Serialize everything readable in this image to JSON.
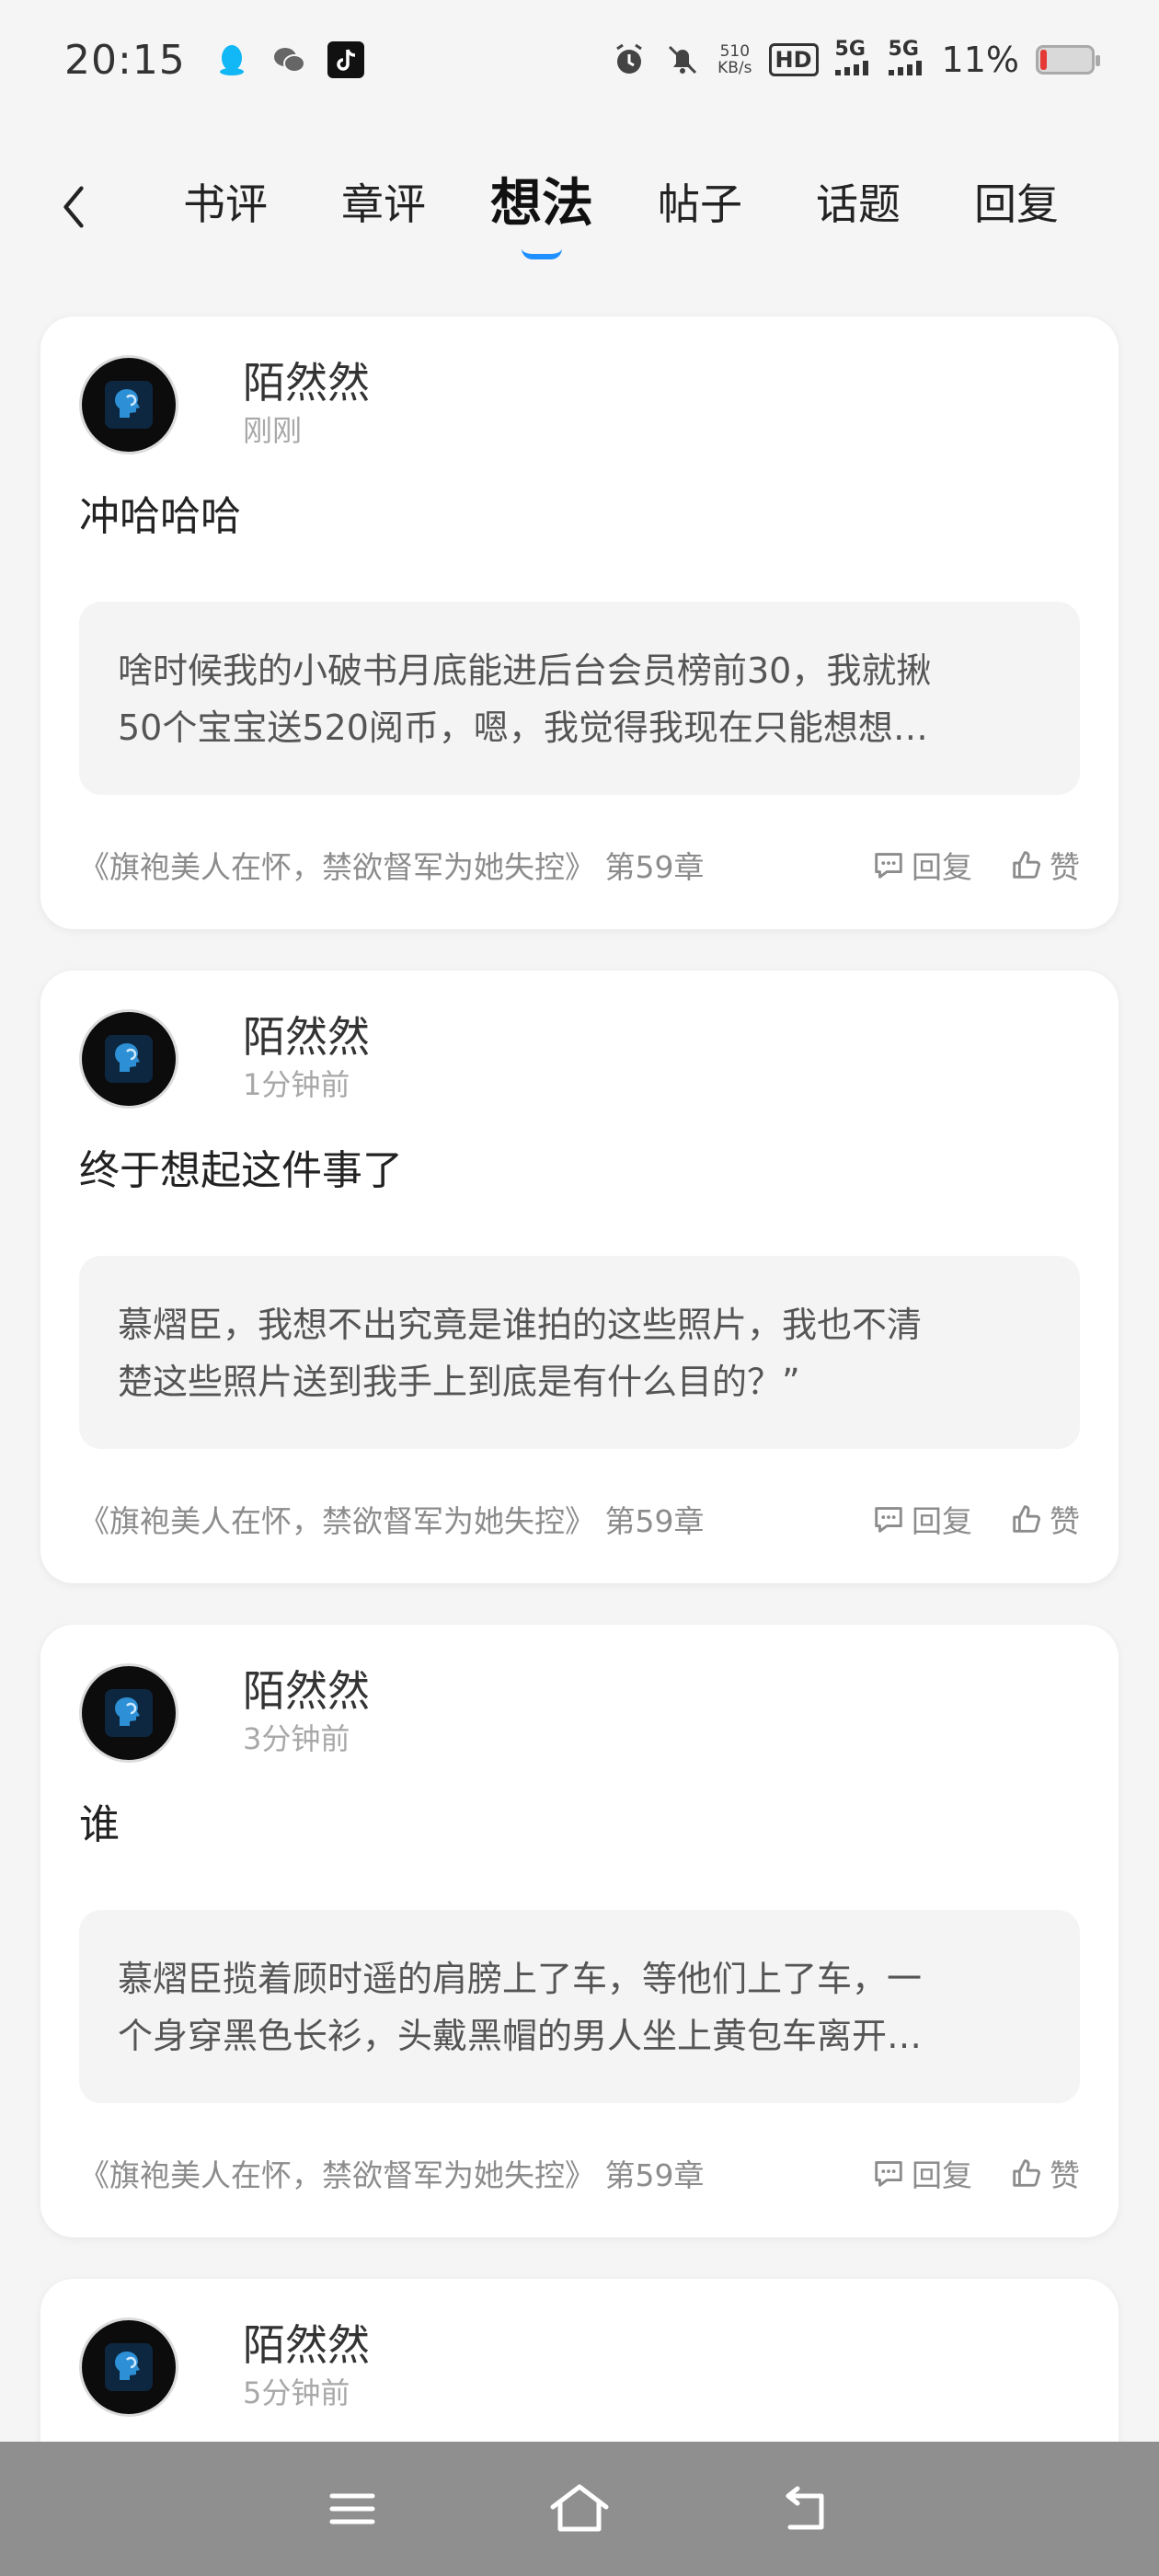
{
  "status_bar": {
    "time": "20:15",
    "net_speed_value": "510",
    "net_speed_unit": "KB/s",
    "hd_label": "HD",
    "signal_1": "5G",
    "signal_2": "5G",
    "battery_percent": "11%"
  },
  "tabs": [
    {
      "label": "书评",
      "active": false
    },
    {
      "label": "章评",
      "active": false
    },
    {
      "label": "想法",
      "active": true
    },
    {
      "label": "帖子",
      "active": false
    },
    {
      "label": "话题",
      "active": false
    },
    {
      "label": "回复",
      "active": false
    }
  ],
  "posts": [
    {
      "username": "陌然然",
      "time": "刚刚",
      "content": "冲哈哈哈",
      "quote_line1": "啥时候我的小破书月底能进后台会员榜前30，我就揪",
      "quote_line2": "50个宝宝送520阅币，嗯，我觉得我现在只能想想…",
      "chapter": "《旗袍美人在怀，禁欲督军为她失控》 第59章",
      "reply_label": "回复",
      "like_label": "赞"
    },
    {
      "username": "陌然然",
      "time": "1分钟前",
      "content": "终于想起这件事了",
      "quote_line1": "慕熠臣，我想不出究竟是谁拍的这些照片，我也不清",
      "quote_line2": "楚这些照片送到我手上到底是有什么目的？”",
      "chapter": "《旗袍美人在怀，禁欲督军为她失控》 第59章",
      "reply_label": "回复",
      "like_label": "赞"
    },
    {
      "username": "陌然然",
      "time": "3分钟前",
      "content": "谁",
      "quote_line1": "慕熠臣揽着顾时遥的肩膀上了车，等他们上了车，一",
      "quote_line2": "个身穿黑色长衫，头戴黑帽的男人坐上黄包车离开…",
      "chapter": "《旗袍美人在怀，禁欲督军为她失控》 第59章",
      "reply_label": "回复",
      "like_label": "赞"
    },
    {
      "username": "陌然然",
      "time": "5分钟前"
    }
  ],
  "colors": {
    "accent": "#1e90ff",
    "battery_low": "#e53935",
    "nav_bar": "#8f8f8f"
  },
  "nav": {
    "menu_icon": "menu-icon",
    "home_icon": "home-icon",
    "back_icon": "back-icon"
  }
}
